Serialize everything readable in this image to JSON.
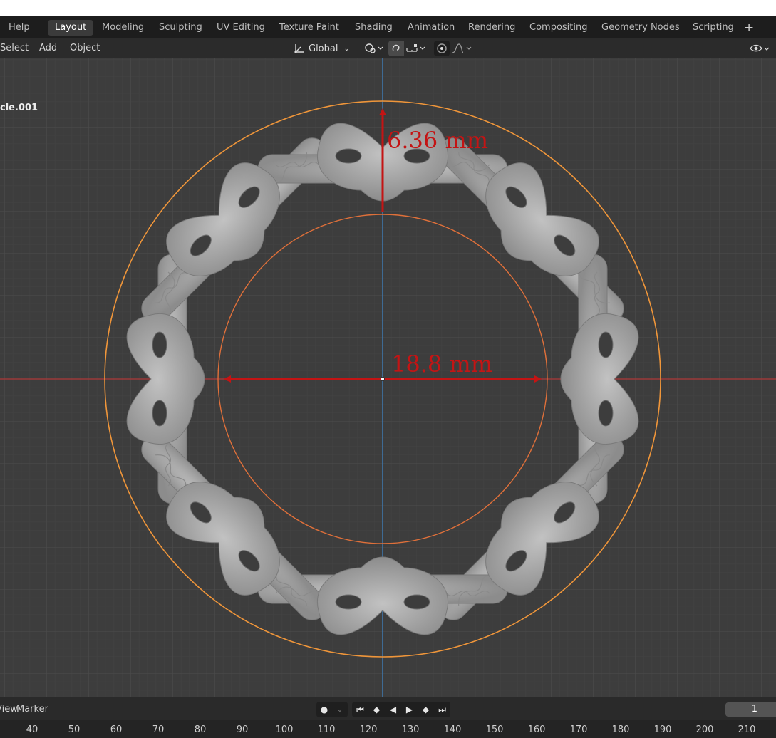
{
  "topbar": {
    "help": "Help",
    "tabs": [
      "Layout",
      "Modeling",
      "Sculpting",
      "UV Editing",
      "Texture Paint",
      "Shading",
      "Animation",
      "Rendering",
      "Compositing",
      "Geometry Nodes",
      "Scripting"
    ],
    "add_tab": "+"
  },
  "toolbar": {
    "select": "Select",
    "add": "Add",
    "object": "Object",
    "orientation": "Global",
    "icons": [
      "transform-orientation-icon",
      "pivot-icon",
      "snap-icon",
      "proportional-edit-icon",
      "falloff-icon",
      "visibility-icon"
    ]
  },
  "viewport": {
    "object_name": "cle.001",
    "dimension_height": "6.36 mm",
    "dimension_inner_diameter": "18.8 mm",
    "colors": {
      "background": "#3d3d3d",
      "grid": "#4a4a4a",
      "x_axis": "#9c3a3a",
      "y_axis": "#3f79b0",
      "outer_circle": "#f0963a",
      "inner_circle": "#e0703a",
      "dimension": "#c41414",
      "mesh": "#9a9a9a"
    }
  },
  "timeline": {
    "view": "View",
    "marker": "Marker",
    "current_frame": "1",
    "ticks": [
      "40",
      "50",
      "60",
      "70",
      "80",
      "90",
      "100",
      "110",
      "120",
      "130",
      "140",
      "150",
      "160",
      "170",
      "180",
      "190",
      "200",
      "210"
    ]
  }
}
